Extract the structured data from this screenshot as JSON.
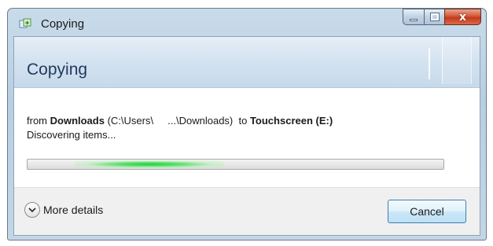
{
  "window": {
    "title": "Copying",
    "controls": {
      "minimize_icon": "minimize-icon",
      "maximize_icon": "maximize-icon",
      "close_label": "x"
    }
  },
  "header": {
    "title": "Copying"
  },
  "copy": {
    "from_word": "from",
    "source_name": "Downloads",
    "source_path_start": "(C:\\Users\\",
    "source_path_end": "...\\Downloads)",
    "to_word": "to",
    "dest_name": "Touchscreen (E:)",
    "status": "Discovering items..."
  },
  "progress": {
    "state": "indeterminate",
    "color": "#18d23a"
  },
  "footer": {
    "more_details_label": "More details",
    "cancel_label": "Cancel"
  },
  "colors": {
    "header_title": "#1e3a5c",
    "cancel_border": "#3c7fb1"
  }
}
